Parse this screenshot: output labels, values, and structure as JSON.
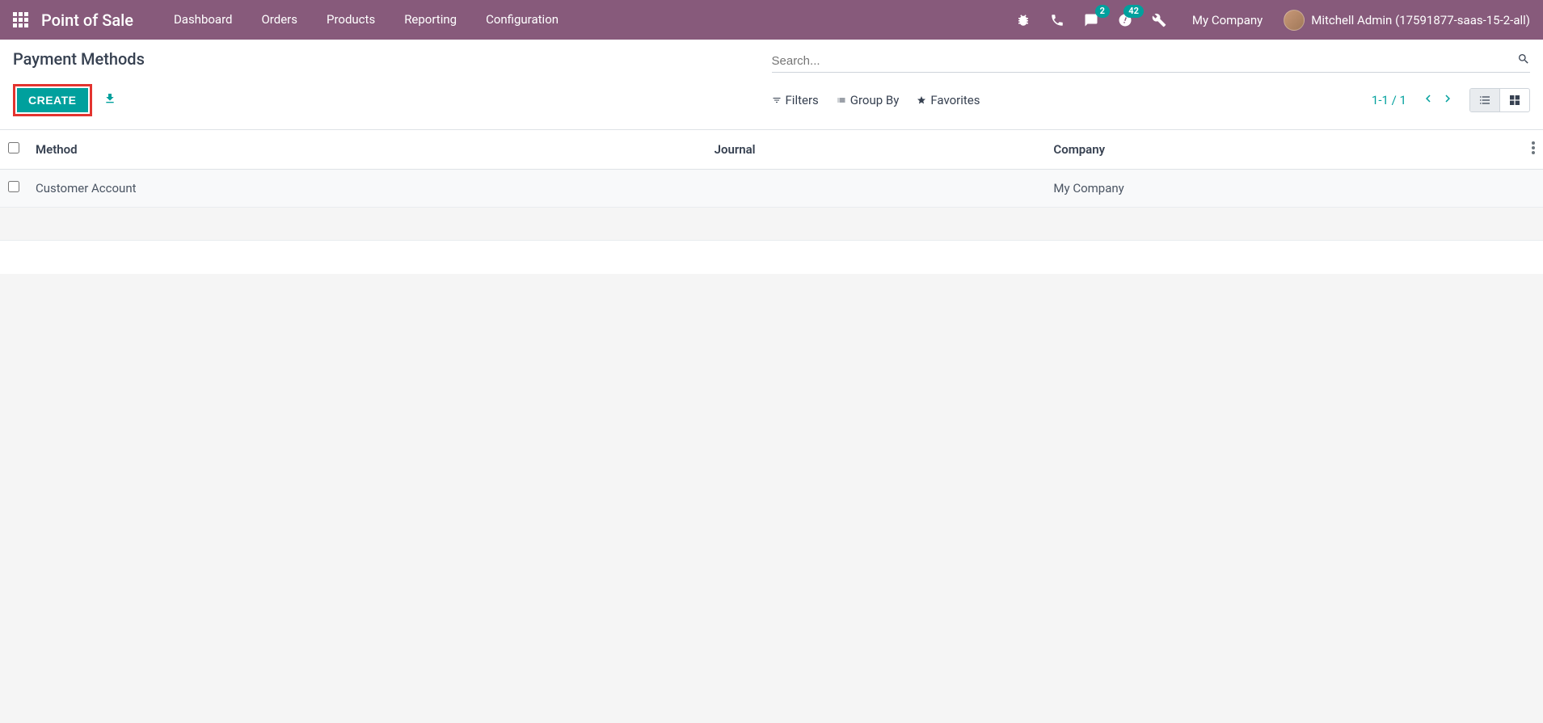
{
  "topnav": {
    "brand": "Point of Sale",
    "items": [
      "Dashboard",
      "Orders",
      "Products",
      "Reporting",
      "Configuration"
    ],
    "company": "My Company",
    "user": "Mitchell Admin (17591877-saas-15-2-all)",
    "messages_badge": "2",
    "activities_badge": "42"
  },
  "control": {
    "title": "Payment Methods",
    "search_placeholder": "Search...",
    "create_label": "CREATE",
    "filters_label": "Filters",
    "groupby_label": "Group By",
    "favorites_label": "Favorites",
    "pager": "1-1 / 1"
  },
  "table": {
    "headers": {
      "method": "Method",
      "journal": "Journal",
      "company": "Company"
    },
    "rows": [
      {
        "method": "Customer Account",
        "journal": "",
        "company": "My Company"
      }
    ]
  }
}
